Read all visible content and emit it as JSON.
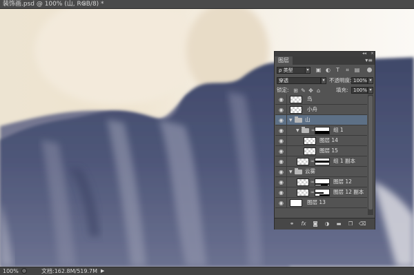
{
  "document": {
    "title": "装饰画.psd @ 100% (山, RGB/8) *",
    "close_glyph": "×"
  },
  "status_bar": {
    "zoom": "100%",
    "doc_info": "文档:162.8M/519.7M",
    "arrow": "▶"
  },
  "layers_panel": {
    "collapse_glyph": "◂◂",
    "close_glyph": "×",
    "tab_label": "图层",
    "menu_glyph": "▾≡",
    "filter": {
      "kind_value": "类型",
      "search_glyph": "ρ"
    },
    "blend_mode": "穿透",
    "opacity_label": "不透明度:",
    "opacity_value": "100%",
    "lock_label": "锁定:",
    "fill_label": "填充:",
    "fill_value": "100%",
    "layers": [
      {
        "name": "鸟",
        "type": "layer",
        "depth": 0,
        "thumb": "transparent"
      },
      {
        "name": "小舟",
        "type": "layer",
        "depth": 0,
        "thumb": "transparent"
      },
      {
        "name": "山",
        "type": "group",
        "depth": 0,
        "expanded": true,
        "selected": true
      },
      {
        "name": "组 1",
        "type": "group",
        "depth": 1,
        "expanded": true,
        "has_mask": true
      },
      {
        "name": "图层 14",
        "type": "layer",
        "depth": 2,
        "thumb": "transparent"
      },
      {
        "name": "图层 15",
        "type": "layer",
        "depth": 2,
        "thumb": "transparent"
      },
      {
        "name": "组 1 副本",
        "type": "layer",
        "depth": 1,
        "thumb": "transparent",
        "has_mask": true
      },
      {
        "name": "云雾",
        "type": "group",
        "depth": 0,
        "expanded": true
      },
      {
        "name": "图层 12",
        "type": "layer",
        "depth": 1,
        "thumb": "transparent",
        "has_mask": true
      },
      {
        "name": "图层 12 副本",
        "type": "layer",
        "depth": 1,
        "thumb": "transparent",
        "has_mask": true
      },
      {
        "name": "图层 13",
        "type": "layer",
        "depth": 0,
        "thumb": "white"
      }
    ],
    "footer_icons": [
      "link-icon",
      "fx-icon",
      "add-mask-icon",
      "adjustment-icon",
      "new-group-icon",
      "new-layer-icon",
      "trash-icon"
    ]
  },
  "colors": {
    "panel_bg": "#535353",
    "selected_row": "#5d7086",
    "mountain_blue": "#4f5779",
    "sky_cream": "#efe6d4"
  }
}
